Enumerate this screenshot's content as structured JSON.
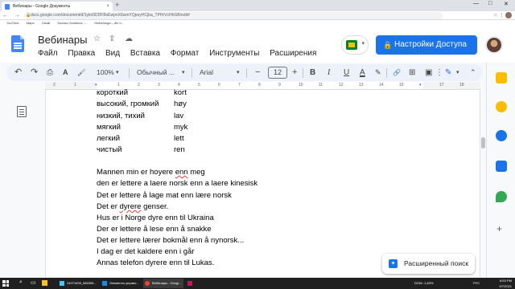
{
  "browser": {
    "tab_title": "Вебинары - Google Документы",
    "tab_close": "×",
    "new_tab": "+",
    "window_controls": [
      "—",
      "□",
      "✕"
    ],
    "nav_glyphs": "← → ⟳",
    "url": "docs.google.com/document/d/1ykn5DDFBxEwpnX6wmYQpeyHCjba_TPHrVcHhGB/edit#",
    "lock_glyph": "🔒",
    "right_icons": "☆ ⋮",
    "bookmarks": [
      "YouTube",
      "Maps",
      "Gmail",
      "Sudoku Solutions -...",
      "Heibelnoga – din h..."
    ]
  },
  "doc": {
    "title": "Вебинары",
    "title_icons": [
      "☆",
      "⇪",
      "☁"
    ],
    "menu": [
      "Файл",
      "Правка",
      "Вид",
      "Вставка",
      "Формат",
      "Инструменты",
      "Расширения"
    ],
    "share_label": "Настройки Доступа",
    "share_icon": "lock-icon"
  },
  "toolbar": {
    "undo": "↶",
    "redo": "↷",
    "print": "⎙",
    "spellcheck": "A",
    "paint_format": "🖌",
    "zoom": "100%",
    "style": "Обычный ...",
    "font": "Arial",
    "font_size": "12",
    "minus": "−",
    "plus": "+",
    "bold": "B",
    "italic": "I",
    "underline": "U",
    "text_color": "A",
    "highlight": "✎",
    "link": "🔗",
    "comment": "⊞",
    "image": "▣",
    "more": "⋮",
    "edit_mode": "✎"
  },
  "ruler": {
    "numbers": [
      "2",
      "1",
      "1",
      "2",
      "3",
      "4",
      "5",
      "6",
      "7",
      "8",
      "9",
      "10",
      "11",
      "12",
      "13",
      "14",
      "15",
      "16",
      "17",
      "18"
    ]
  },
  "content": {
    "word_pairs": [
      {
        "ru": "короткий",
        "no": "kort"
      },
      {
        "ru": "высокий, громкий",
        "no": "høy"
      },
      {
        "ru": "низкий, тихий",
        "no": "lav"
      },
      {
        "ru": "мягкий",
        "no": "myk"
      },
      {
        "ru": "легкий",
        "no": "lett"
      },
      {
        "ru": "чистый",
        "no": "ren"
      }
    ],
    "sentences": [
      {
        "pre": "Mannen min er hoyere ",
        "err": "enn",
        "post": " meg"
      },
      {
        "pre": "den er lettere a laere norsk enn a laere kinesisk",
        "err": "",
        "post": ""
      },
      {
        "pre": "Det er lettere å lage mat enn lære norsk",
        "err": "",
        "post": ""
      },
      {
        "pre": "Det er ",
        "err": "dyrere",
        "post": " genser."
      },
      {
        "pre": "Hus er i Norge dyre enn til Ukraina",
        "err": "",
        "post": ""
      },
      {
        "pre": "Der er lettere å lese enn å snakke",
        "err": "",
        "post": ""
      },
      {
        "pre": "Det er lettere lærer bokmål enn å nynorsk...",
        "err": "",
        "post": ""
      },
      {
        "pre": "I dag er det kaldere enn i går",
        "err": "",
        "post": ""
      },
      {
        "pre": "Annas telefon dyrere enn til Lukas.",
        "err": "",
        "post": ""
      }
    ]
  },
  "explore": {
    "label": "Расширенный поиск",
    "icon": "explore-star-icon"
  },
  "taskbar": {
    "items": [
      "24071699_585305...",
      "Элементы управл...",
      "Вебинары - Googl...",
      ""
    ],
    "tray_left": "DOW  -1,63%",
    "time": "8:53 PM",
    "date": "9/7/2021",
    "lang": "РУС"
  },
  "colors": {
    "accent": "#1a73e8",
    "doc_blue": "#4285f4",
    "spell_error": "#ea4335"
  }
}
